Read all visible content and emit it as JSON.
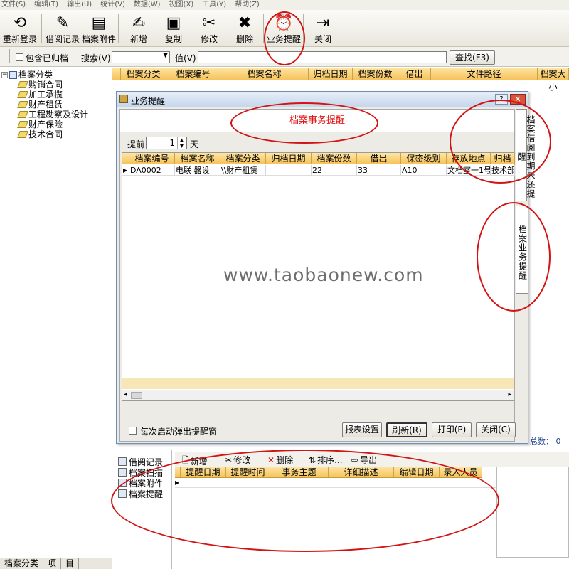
{
  "menu": [
    "文件(S)",
    "编辑(T)",
    "输出(U)",
    "统计(V)",
    "数据(W)",
    "视图(X)",
    "工具(Y)",
    "帮助(Z)"
  ],
  "toolbar": {
    "relogin": "重新登录",
    "borrow_record": "借阅记录",
    "attachment": "档案附件",
    "add": "新增",
    "copy": "复制",
    "edit": "修改",
    "delete": "删除",
    "reminder": "业务提醒",
    "close": "关闭"
  },
  "search": {
    "include_archived": "包含已归档",
    "search_label": "搜索(V)",
    "value_label": "值(V)",
    "find_button": "查找(F3)"
  },
  "tree": {
    "root": "档案分类",
    "items": [
      "购销合同",
      "加工承揽",
      "财产租赁",
      "工程勘察及设计",
      "财产保险",
      "技术合同"
    ]
  },
  "main_grid": {
    "columns": [
      "档案分类",
      "档案编号",
      "档案名称",
      "归档日期",
      "档案份数",
      "借出",
      "文件路径",
      "档案大小"
    ]
  },
  "dialog": {
    "title": "业务提醒",
    "heading": "档案事务提醒",
    "days_before_label": "提前",
    "days_value": "1",
    "days_unit": "天",
    "columns": [
      "档案编号",
      "档案名称",
      "档案分类",
      "归档日期",
      "档案份数",
      "借出",
      "保密级别",
      "存放地点",
      "归档"
    ],
    "rows": [
      {
        "num": "DA0002",
        "name": "电联   器设",
        "cat": "\\\\财产租赁",
        "date": "",
        "copies": "22",
        "out": "33",
        "level": "A10",
        "loc": "文档室一1号",
        "dept": "技术部"
      }
    ],
    "popup_checkbox": "每次启动弹出提醒窗",
    "report_settings": "报表设置",
    "refresh": "刷新(R)",
    "print": "打印(P)",
    "close": "关闭(C)",
    "tab_overdue": "档案借阅到期未还提醒",
    "tab_business": "档案业务提醒"
  },
  "total_label": "总数： 0",
  "watermark": "www.taobaonew.com",
  "bottom_panel": {
    "tabs": [
      "借阅记录",
      "档案扫描",
      "档案附件",
      "档案提醒"
    ],
    "toolbar": {
      "add": "新增",
      "edit": "修改",
      "delete": "删除",
      "sort": "排序...",
      "export": "导出"
    },
    "columns": [
      "提醒日期",
      "提醒时间",
      "事务主题",
      "详细描述",
      "编辑日期",
      "录入人员"
    ]
  },
  "statusbar": [
    "档案分类",
    "项",
    "目"
  ],
  "colors": {
    "annotation": "#d21414",
    "grid_header": "#f7c35a",
    "heading_text": "#e01010"
  }
}
